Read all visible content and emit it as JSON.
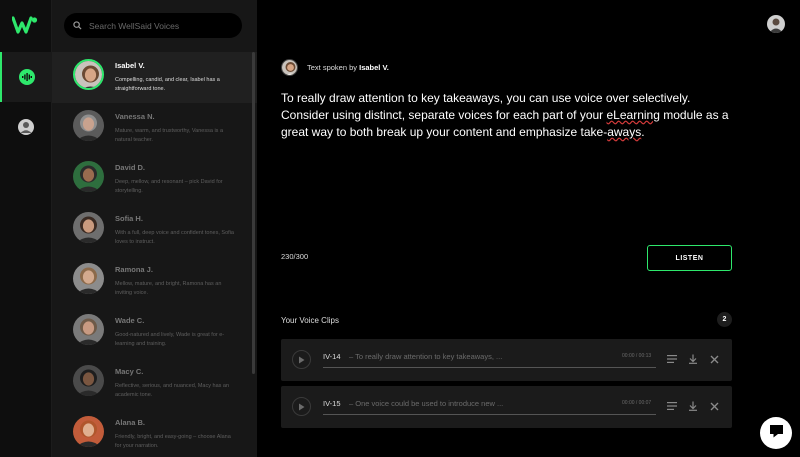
{
  "search": {
    "placeholder": "Search WellSaid Voices"
  },
  "voices": [
    {
      "name": "Isabel V.",
      "desc": "Compelling, candid, and clear, Isabel has a straightforward tone.",
      "skin": "#d7a686",
      "hair": "#6b4a33",
      "bg": "#c9c3bc",
      "selected": true
    },
    {
      "name": "Vanessa N.",
      "desc": "Mature, warm, and trustworthy, Vanessa is a natural teacher.",
      "skin": "#c9a28e",
      "hair": "#8f8f8f",
      "bg": "#5b5b5b"
    },
    {
      "name": "David D.",
      "desc": "Deep, mellow, and resonant – pick David for storytelling.",
      "skin": "#9a6b4f",
      "hair": "#2b2b2b",
      "bg": "#2e6e3e"
    },
    {
      "name": "Sofia H.",
      "desc": "With a full, deep voice and confident tones, Sofia loves to instruct.",
      "skin": "#c99a7e",
      "hair": "#3a2a22",
      "bg": "#6e6e6e"
    },
    {
      "name": "Ramona J.",
      "desc": "Mellow, mature, and bright, Ramona has an inviting voice.",
      "skin": "#d4aa8e",
      "hair": "#8c6a4a",
      "bg": "#8c8c8c"
    },
    {
      "name": "Wade C.",
      "desc": "Good-natured and lively, Wade is great for e-learning and training.",
      "skin": "#c89a82",
      "hair": "#6e5a48",
      "bg": "#7a7a7a"
    },
    {
      "name": "Macy C.",
      "desc": "Reflective, serious, and nuanced, Macy has an academic tone.",
      "skin": "#7a5640",
      "hair": "#1e1e1e",
      "bg": "#4a4a4a"
    },
    {
      "name": "Alana B.",
      "desc": "Friendly, bright, and easy-going – choose Alana for your narration.",
      "skin": "#e0b090",
      "hair": "#b0562c",
      "bg": "#c25c3a"
    }
  ],
  "main": {
    "spoken_prefix": "Text spoken by",
    "spoken_name": "Isabel V.",
    "script_part1": "To really draw attention to key takeaways, you can use voice over selectively. Consider using distinct, separate voices for each part of your ",
    "script_underlined": "eLearning",
    "script_part2": " module as a great way to both break up your content and emphasize take-",
    "script_underlined2": "aways",
    "script_part3": ".",
    "counter": "230/300",
    "listen_label": "LISTEN",
    "clips_title": "Your Voice Clips",
    "clips_count": "2",
    "clips": [
      {
        "id": "IV-14",
        "text": "– To really draw attention to key takeaways, ...",
        "time": "00:00 / 00:13"
      },
      {
        "id": "IV-15",
        "text": "– One voice could be used to introduce new ...",
        "time": "00:00 / 00:07"
      }
    ]
  },
  "colors": {
    "accent": "#2ee86c",
    "panel": "#171717",
    "background": "#000000"
  },
  "icons": [
    "wellsaid-logo-icon",
    "voice-wave-icon",
    "user-icon",
    "search-icon",
    "play-icon",
    "menu-lines-icon",
    "download-icon",
    "close-icon",
    "chat-icon"
  ]
}
